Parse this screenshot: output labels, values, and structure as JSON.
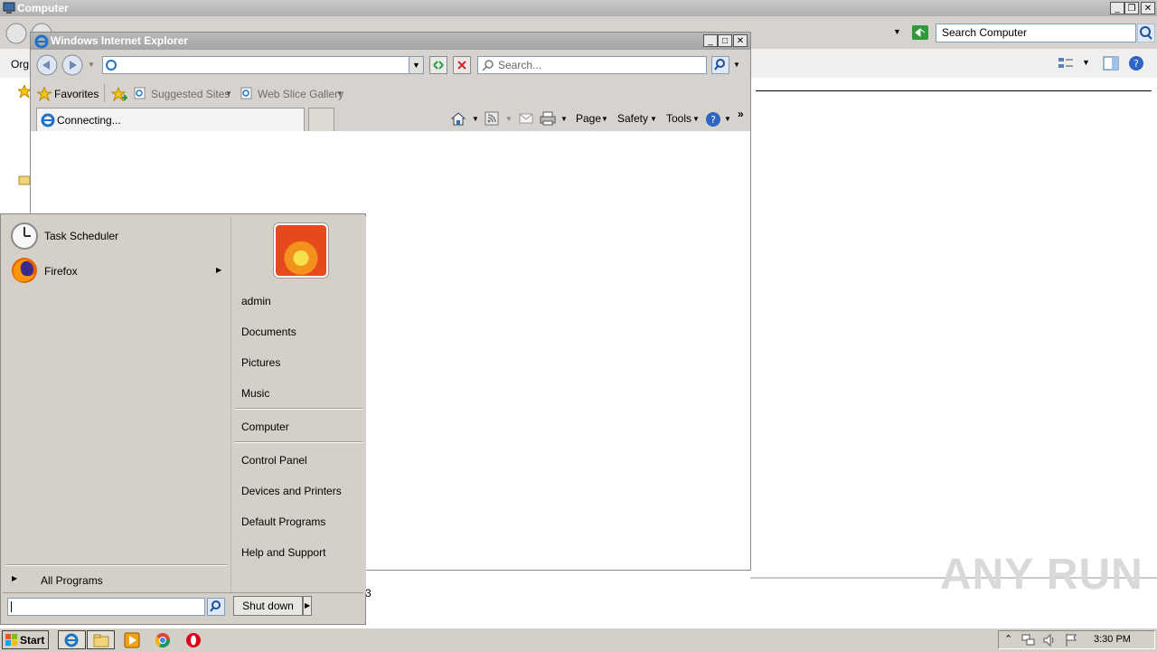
{
  "explorer": {
    "title": "Computer",
    "search_placeholder": "Search Computer",
    "toolbar_partial": "Org",
    "status_fragment": "3"
  },
  "ie": {
    "title": "Windows Internet Explorer",
    "search_placeholder": "Search...",
    "favorites_label": "Favorites",
    "suggested_sites": "Suggested Sites",
    "web_slice_gallery": "Web Slice Gallery",
    "tab_label": "Connecting...",
    "commands": {
      "page": "Page",
      "safety": "Safety",
      "tools": "Tools"
    }
  },
  "start_menu": {
    "programs": [
      {
        "label": "Task Scheduler",
        "icon": "clock-icon"
      },
      {
        "label": "Firefox",
        "icon": "firefox-icon"
      }
    ],
    "all_programs": "All Programs",
    "user": "admin",
    "places_1": [
      "Documents",
      "Pictures",
      "Music"
    ],
    "places_2": [
      "Computer"
    ],
    "places_3": [
      "Control Panel",
      "Devices and Printers",
      "Default Programs",
      "Help and Support"
    ],
    "shutdown_label": "Shut down"
  },
  "taskbar": {
    "start_label": "Start",
    "clock": "3:30 PM"
  },
  "watermark": "ANY RUN"
}
